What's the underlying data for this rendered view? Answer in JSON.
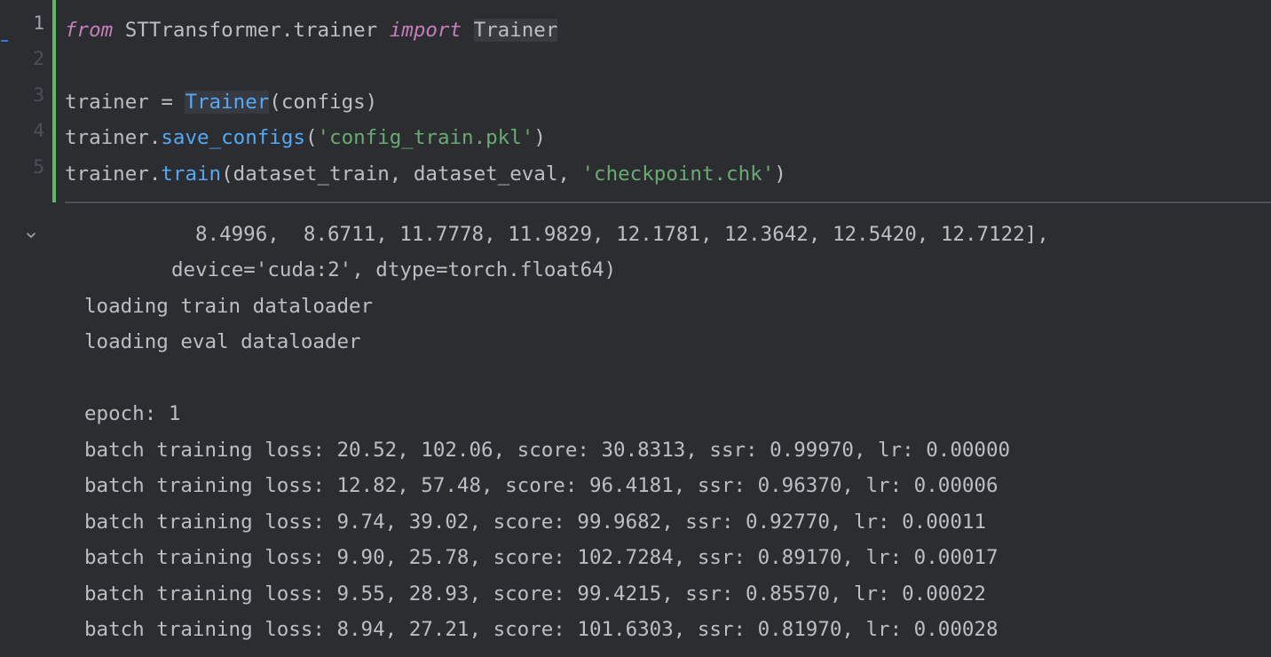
{
  "code_cell": {
    "line_numbers": [
      "1",
      "2",
      "3",
      "4",
      "5"
    ],
    "line1": {
      "kw_from": "from",
      "module": " STTransformer.trainer ",
      "kw_import": "import",
      "space": " ",
      "name": "Trainer"
    },
    "line3": {
      "var": "trainer = ",
      "cls": "Trainer",
      "args": "(configs)"
    },
    "line4": {
      "obj": "trainer.",
      "method": "save_configs",
      "open": "(",
      "str": "'config_train.pkl'",
      "close": ")"
    },
    "line5": {
      "obj": "trainer.",
      "method": "train",
      "args": "(dataset_train, dataset_eval, ",
      "str": "'checkpoint.chk'",
      "close": ")"
    }
  },
  "output": {
    "collapse_icon": "chevron-down-icon",
    "lines": [
      "8.4996,  8.6711, 11.7778, 11.9829, 12.1781, 12.3642, 12.5420, 12.7122],",
      "device='cuda:2', dtype=torch.float64)",
      "loading train dataloader",
      "loading eval dataloader",
      "epoch: 1",
      "batch training loss: 20.52, 102.06, score: 30.8313, ssr: 0.99970, lr: 0.00000",
      "batch training loss: 12.82, 57.48, score: 96.4181, ssr: 0.96370, lr: 0.00006",
      "batch training loss: 9.74, 39.02, score: 99.9682, ssr: 0.92770, lr: 0.00011",
      "batch training loss: 9.90, 25.78, score: 102.7284, ssr: 0.89170, lr: 0.00017",
      "batch training loss: 9.55, 28.93, score: 99.4215, ssr: 0.85570, lr: 0.00022",
      "batch training loss: 8.94, 27.21, score: 101.6303, ssr: 0.81970, lr: 0.00028"
    ]
  },
  "colors": {
    "background": "#2b2d30",
    "keyword": "#c77dbb",
    "string": "#6aab73",
    "function": "#56a8f5",
    "text": "#bcbec4",
    "cell_accent": "#5fb865",
    "exec_marker": "#3574f0"
  }
}
